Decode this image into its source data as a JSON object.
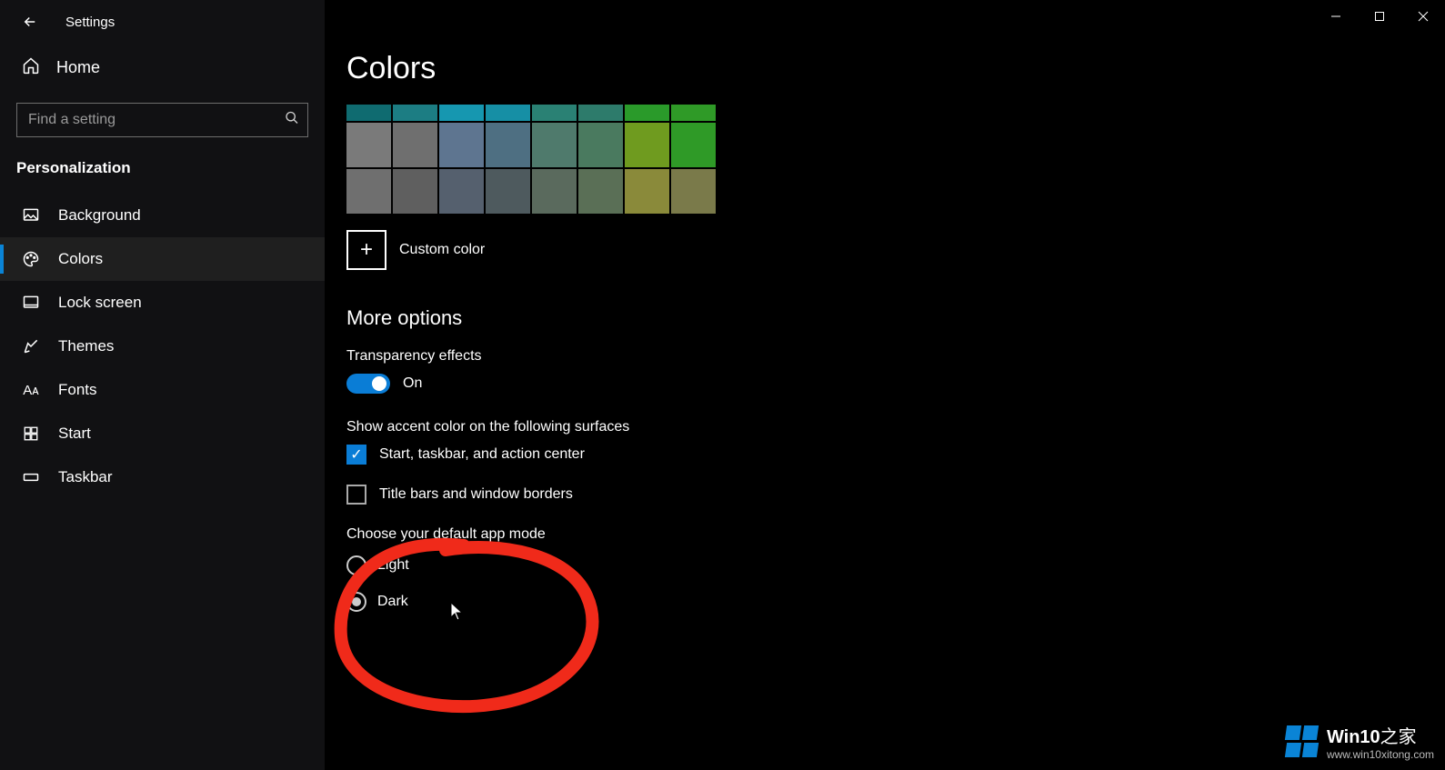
{
  "app": {
    "title": "Settings"
  },
  "sidebar": {
    "home": "Home",
    "search_placeholder": "Find a setting",
    "category": "Personalization",
    "items": [
      {
        "label": "Background",
        "id": "background"
      },
      {
        "label": "Colors",
        "id": "colors",
        "selected": true
      },
      {
        "label": "Lock screen",
        "id": "lock-screen"
      },
      {
        "label": "Themes",
        "id": "themes"
      },
      {
        "label": "Fonts",
        "id": "fonts"
      },
      {
        "label": "Start",
        "id": "start"
      },
      {
        "label": "Taskbar",
        "id": "taskbar"
      }
    ]
  },
  "main": {
    "page_title": "Colors",
    "swatches_row_half": [
      "#0f6b70",
      "#1c7d83",
      "#1697b0",
      "#168fa5",
      "#2a8174",
      "#2d7b6b",
      "#2a9a2a",
      "#2f9a27"
    ],
    "swatches_row1": [
      "#7a7a7a",
      "#6f6f6f",
      "#5e7590",
      "#4e6f82",
      "#4f7a6c",
      "#4a7a5f",
      "#6f9b1f",
      "#2f9a27"
    ],
    "swatches_row2": [
      "#6f6f6f",
      "#5f5f5f",
      "#55606e",
      "#4e5a5e",
      "#5a6a5d",
      "#5a6f56",
      "#8a8a3a",
      "#7a7a4a"
    ],
    "custom_color_label": "Custom color",
    "section_heading": "More options",
    "transparency": {
      "label": "Transparency effects",
      "status": "On",
      "on": true
    },
    "accent_surfaces": {
      "label": "Show accent color on the following surfaces",
      "opt1": {
        "label": "Start, taskbar, and action center",
        "checked": true
      },
      "opt2": {
        "label": "Title bars and window borders",
        "checked": false
      }
    },
    "app_mode": {
      "label": "Choose your default app mode",
      "light": "Light",
      "dark": "Dark",
      "selected": "dark"
    }
  },
  "watermark": {
    "brand1": "Win10",
    "brand2": "之家",
    "url": "www.win10xitong.com"
  }
}
